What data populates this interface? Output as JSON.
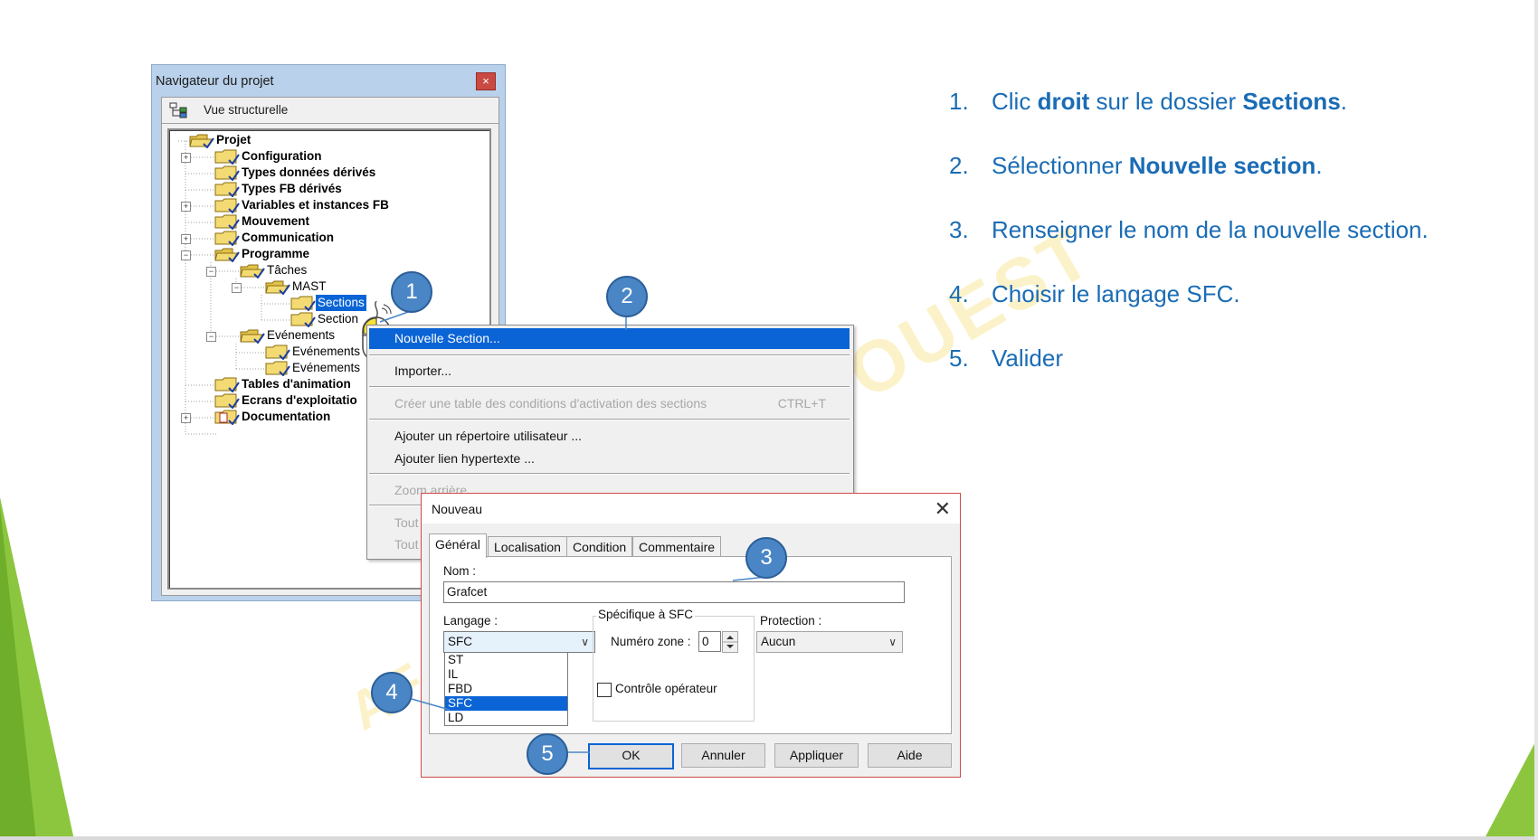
{
  "navigator": {
    "title": "Navigateur du projet",
    "close": "×",
    "view_tab": "Vue structurelle",
    "tree": [
      {
        "label": "Projet",
        "bold": true
      },
      {
        "label": "Configuration",
        "bold": true
      },
      {
        "label": "Types données dérivés",
        "bold": true
      },
      {
        "label": "Types FB dérivés",
        "bold": true
      },
      {
        "label": "Variables et instances FB",
        "bold": true
      },
      {
        "label": "Mouvement",
        "bold": true
      },
      {
        "label": "Communication",
        "bold": true
      },
      {
        "label": "Programme",
        "bold": true
      },
      {
        "label": "Tâches",
        "bold": false
      },
      {
        "label": "MAST",
        "bold": false
      },
      {
        "label": "Sections",
        "bold": false,
        "selected": true
      },
      {
        "label": "Section",
        "bold": false
      },
      {
        "label": "Evénements",
        "bold": false
      },
      {
        "label": "Evénements",
        "bold": false
      },
      {
        "label": "Evénements",
        "bold": false
      },
      {
        "label": "Tables d'animation",
        "bold": true
      },
      {
        "label": "Ecrans d'exploitatio",
        "bold": true
      },
      {
        "label": "Documentation",
        "bold": true
      }
    ]
  },
  "context_menu": {
    "items": [
      {
        "label": "Nouvelle Section...",
        "highlighted": true
      },
      {
        "label": "Importer..."
      },
      {
        "label": "Créer une table des conditions d'activation des sections",
        "disabled": true,
        "shortcut": "CTRL+T"
      },
      {
        "label": "Ajouter un répertoire utilisateur ..."
      },
      {
        "label": "Ajouter lien hypertexte ..."
      },
      {
        "label": "Zoom arrière",
        "disabled": true
      },
      {
        "label": "Tout",
        "disabled": true
      },
      {
        "label": "Tout",
        "disabled": true
      }
    ]
  },
  "dialog": {
    "title": "Nouveau",
    "close": "✕",
    "tabs": [
      "Général",
      "Localisation",
      "Condition",
      "Commentaire"
    ],
    "name_label": "Nom :",
    "name_value": "Grafcet",
    "language_label": "Langage :",
    "language_value": "SFC",
    "language_options": [
      "ST",
      "IL",
      "FBD",
      "SFC",
      "LD"
    ],
    "sfc_group_label": "Spécifique à SFC",
    "zone_label": "Numéro zone :",
    "zone_value": "0",
    "operator_check_label": "Contrôle opérateur",
    "protection_label": "Protection :",
    "protection_value": "Aucun",
    "buttons": {
      "ok": "OK",
      "cancel": "Annuler",
      "apply": "Appliquer",
      "help": "Aide"
    }
  },
  "callouts": [
    "1",
    "2",
    "3",
    "4",
    "5"
  ],
  "steps": [
    {
      "num": "1.",
      "parts": [
        {
          "t": "Clic "
        },
        {
          "t": "droit",
          "b": true
        },
        {
          "t": " sur le dossier "
        },
        {
          "t": "Sections",
          "b": true
        },
        {
          "t": "."
        }
      ]
    },
    {
      "num": "2.",
      "parts": [
        {
          "t": "Sélectionner "
        },
        {
          "t": "Nouvelle section",
          "b": true
        },
        {
          "t": "."
        }
      ]
    },
    {
      "num": "3.",
      "parts": [
        {
          "t": "Renseigner le nom de la nouvelle section."
        }
      ]
    },
    {
      "num": "4.",
      "parts": [
        {
          "t": "Choisir le langage SFC."
        }
      ]
    },
    {
      "num": "5.",
      "parts": [
        {
          "t": "Valider"
        }
      ]
    }
  ],
  "colors": {
    "accent_blue": "#1a6cb5",
    "selection": "#0a64d6",
    "bubble": "#4a86c6",
    "green": "#8cc63f"
  }
}
